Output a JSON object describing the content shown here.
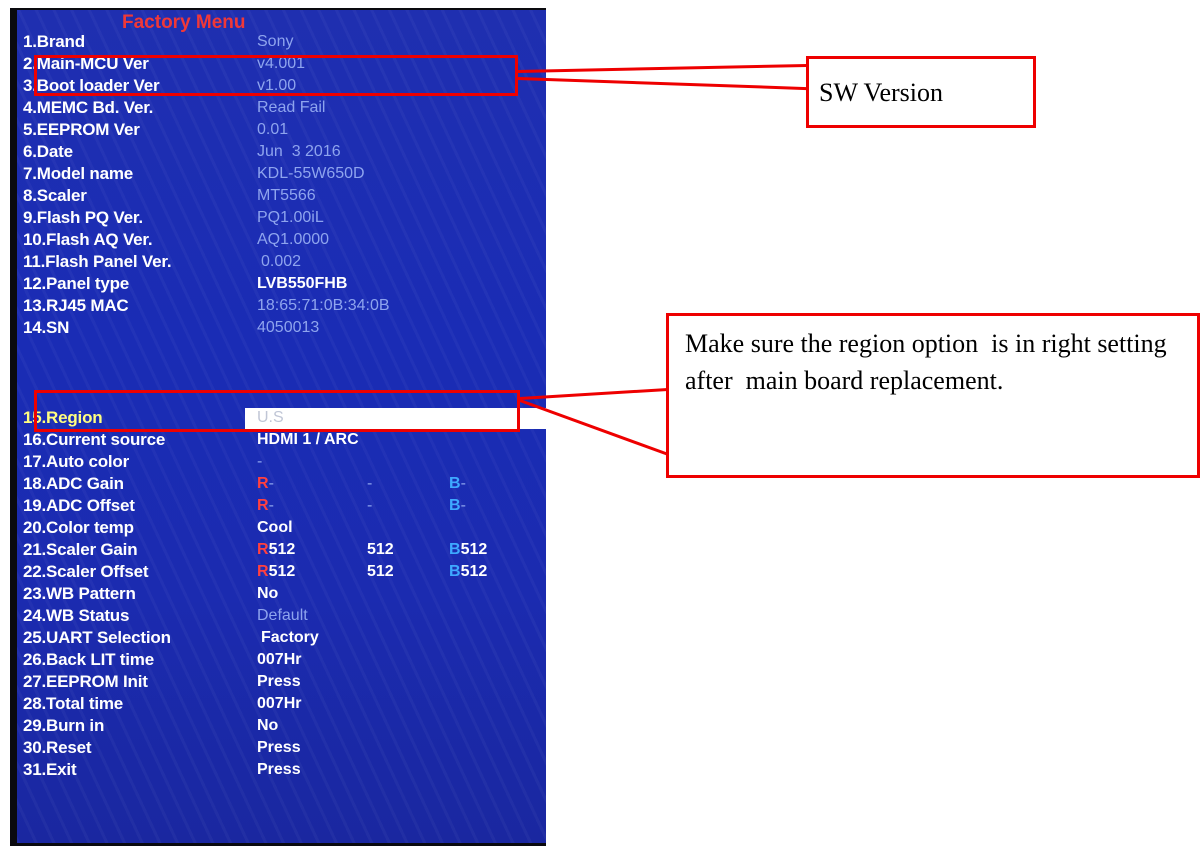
{
  "menu": {
    "title": "Factory Menu",
    "rows": [
      {
        "label": "1.Brand",
        "value": "Sony"
      },
      {
        "label": "2.Main-MCU Ver",
        "value": "v4.001"
      },
      {
        "label": "3.Boot loader Ver",
        "value": "v1.00"
      },
      {
        "label": "4.MEMC Bd. Ver.",
        "value": "Read Fail"
      },
      {
        "label": "5.EEPROM Ver",
        "value": "0.01"
      },
      {
        "label": "6.Date",
        "value": "Jun  3 2016"
      },
      {
        "label": "7.Model name",
        "value": "KDL-55W650D"
      },
      {
        "label": "8.Scaler",
        "value": "MT5566"
      },
      {
        "label": "9.Flash PQ Ver.",
        "value": "PQ1.00iL"
      },
      {
        "label": "10.Flash AQ Ver.",
        "value": "AQ1.0000"
      },
      {
        "label": "11.Flash Panel Ver.",
        "value": "0.002"
      },
      {
        "label": "12.Panel type",
        "value": "LVB550FHB"
      },
      {
        "label": "13.RJ45 MAC",
        "value": "18:65:71:0B:34:0B"
      },
      {
        "label": "14.SN",
        "value": "4050013"
      },
      {
        "label": "15.Region",
        "value": "U.S"
      },
      {
        "label": "16.Current source",
        "value": "HDMI 1 / ARC"
      },
      {
        "label": "17.Auto color",
        "value": "-"
      },
      {
        "label": "18.ADC Gain",
        "r": "R",
        "r_val": "-",
        "g": "-",
        "b": "B",
        "b_val": "-"
      },
      {
        "label": "19.ADC Offset",
        "r": "R",
        "r_val": "-",
        "g": "-",
        "b": "B",
        "b_val": "-"
      },
      {
        "label": "20.Color temp",
        "value": "Cool"
      },
      {
        "label": "21.Scaler Gain",
        "r": "R",
        "r_val": "512",
        "g": "512",
        "b": "B",
        "b_val": "512"
      },
      {
        "label": "22.Scaler Offset",
        "r": "R",
        "r_val": "512",
        "g": "512",
        "b": "B",
        "b_val": "512"
      },
      {
        "label": "23.WB Pattern",
        "value": "No"
      },
      {
        "label": "24.WB Status",
        "value": "Default"
      },
      {
        "label": "25.UART Selection",
        "value": "Factory"
      },
      {
        "label": "26.Back LIT time",
        "value": "007Hr"
      },
      {
        "label": "27.EEPROM Init",
        "value": "Press"
      },
      {
        "label": "28.Total time",
        "value": "007Hr"
      },
      {
        "label": "29.Burn in",
        "value": "No"
      },
      {
        "label": "30.Reset",
        "value": "Press"
      },
      {
        "label": "31.Exit",
        "value": "Press"
      }
    ]
  },
  "callouts": {
    "sw_version": "SW Version",
    "region_note": "Make sure the region option  is in right setting  after  main board replacement."
  },
  "colors": {
    "highlight": "#ee0000",
    "menu_background": "#1b2bb0",
    "title": "#f03838"
  }
}
